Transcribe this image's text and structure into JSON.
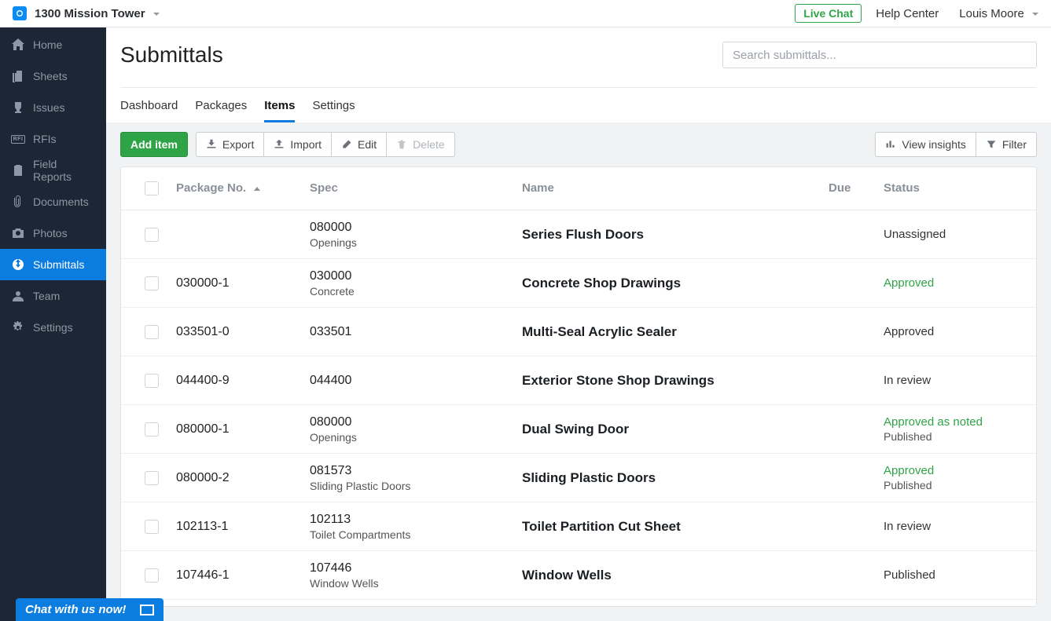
{
  "topbar": {
    "project_name": "1300 Mission Tower",
    "live_chat": "Live Chat",
    "help_center": "Help Center",
    "user_name": "Louis Moore"
  },
  "sidebar": {
    "items": [
      {
        "label": "Home",
        "icon": "home"
      },
      {
        "label": "Sheets",
        "icon": "sheets"
      },
      {
        "label": "Issues",
        "icon": "issues"
      },
      {
        "label": "RFIs",
        "icon": "rfi"
      },
      {
        "label": "Field Reports",
        "icon": "clipboard"
      },
      {
        "label": "Documents",
        "icon": "attachment"
      },
      {
        "label": "Photos",
        "icon": "camera"
      },
      {
        "label": "Submittals",
        "icon": "submittals",
        "active": true
      },
      {
        "label": "Team",
        "icon": "team"
      },
      {
        "label": "Settings",
        "icon": "gear"
      }
    ]
  },
  "page": {
    "title": "Submittals",
    "search_placeholder": "Search submittals..."
  },
  "tabs": [
    {
      "label": "Dashboard"
    },
    {
      "label": "Packages"
    },
    {
      "label": "Items",
      "active": true
    },
    {
      "label": "Settings"
    }
  ],
  "toolbar": {
    "add_item": "Add item",
    "export": "Export",
    "import": "Import",
    "edit": "Edit",
    "delete": "Delete",
    "view_insights": "View insights",
    "filter": "Filter"
  },
  "columns": {
    "package_no": "Package No.",
    "spec": "Spec",
    "name": "Name",
    "due": "Due",
    "status": "Status"
  },
  "rows": [
    {
      "package_no": "",
      "spec_code": "080000",
      "spec_name": "Openings",
      "name": "Series Flush Doors",
      "due": "",
      "status": "Unassigned",
      "status_color": "default",
      "status_sub": ""
    },
    {
      "package_no": "030000-1",
      "spec_code": "030000",
      "spec_name": "Concrete",
      "name": "Concrete Shop Drawings",
      "due": "",
      "status": "Approved",
      "status_color": "green",
      "status_sub": ""
    },
    {
      "package_no": "033501-0",
      "spec_code": "033501",
      "spec_name": "",
      "name": "Multi-Seal Acrylic Sealer",
      "due": "",
      "status": "Approved",
      "status_color": "default",
      "status_sub": ""
    },
    {
      "package_no": "044400-9",
      "spec_code": "044400",
      "spec_name": "",
      "name": "Exterior Stone Shop Drawings",
      "due": "",
      "status": "In review",
      "status_color": "default",
      "status_sub": ""
    },
    {
      "package_no": "080000-1",
      "spec_code": "080000",
      "spec_name": "Openings",
      "name": "Dual Swing Door",
      "due": "",
      "status": "Approved as noted",
      "status_color": "green",
      "status_sub": "Published"
    },
    {
      "package_no": "080000-2",
      "spec_code": "081573",
      "spec_name": "Sliding Plastic Doors",
      "name": "Sliding Plastic Doors",
      "due": "",
      "status": "Approved",
      "status_color": "green",
      "status_sub": "Published"
    },
    {
      "package_no": "102113-1",
      "spec_code": "102113",
      "spec_name": "Toilet Compartments",
      "name": "Toilet Partition Cut Sheet",
      "due": "",
      "status": "In review",
      "status_color": "default",
      "status_sub": ""
    },
    {
      "package_no": "107446-1",
      "spec_code": "107446",
      "spec_name": "Window Wells",
      "name": "Window Wells",
      "due": "",
      "status": "Published",
      "status_color": "default",
      "status_sub": ""
    }
  ],
  "chat_widget": {
    "label": "Chat with us now!"
  },
  "colors": {
    "primary_blue": "#0b7ce0",
    "green": "#2fa446",
    "sidebar_bg": "#1d2634"
  }
}
